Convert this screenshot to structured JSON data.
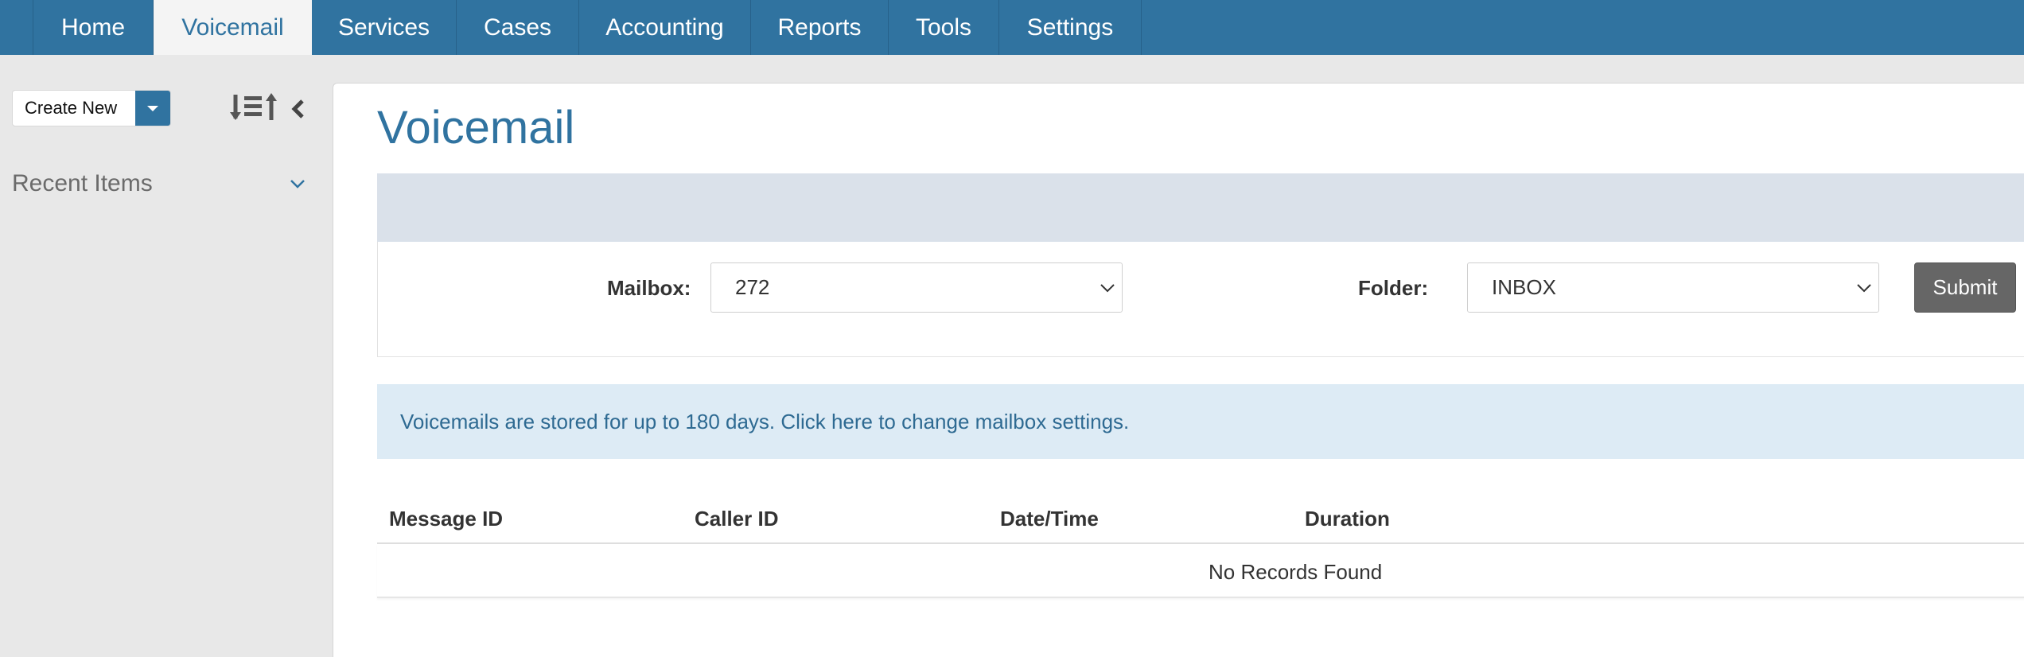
{
  "nav": {
    "items": [
      {
        "label": "Home",
        "active": false
      },
      {
        "label": "Voicemail",
        "active": true
      },
      {
        "label": "Services",
        "active": false
      },
      {
        "label": "Cases",
        "active": false
      },
      {
        "label": "Accounting",
        "active": false
      },
      {
        "label": "Reports",
        "active": false
      },
      {
        "label": "Tools",
        "active": false
      },
      {
        "label": "Settings",
        "active": false
      }
    ]
  },
  "sidebar": {
    "create_new_label": "Create New",
    "recent_items_label": "Recent Items"
  },
  "main": {
    "title": "Voicemail",
    "filter": {
      "mailbox_label": "Mailbox:",
      "mailbox_value": "272",
      "folder_label": "Folder:",
      "folder_value": "INBOX",
      "submit_label": "Submit"
    },
    "info": {
      "text": "Voicemails are stored for up to 180 days. ",
      "link_text": "Click here to change mailbox settings."
    },
    "table": {
      "columns": [
        "Message ID",
        "Caller ID",
        "Date/Time",
        "Duration"
      ],
      "empty_text": "No Records Found"
    }
  },
  "colors": {
    "brand": "#3073a0",
    "info_bg": "#ddebf5",
    "filter_header_bg": "#dae1ea",
    "submit_bg": "#666666"
  },
  "icons": {
    "create_dropdown": "caret-down-icon",
    "sort": "sort-list-icon",
    "collapse": "chevron-left-icon",
    "recent_toggle": "chevron-down-icon",
    "select_arrow": "chevron-down-icon"
  }
}
